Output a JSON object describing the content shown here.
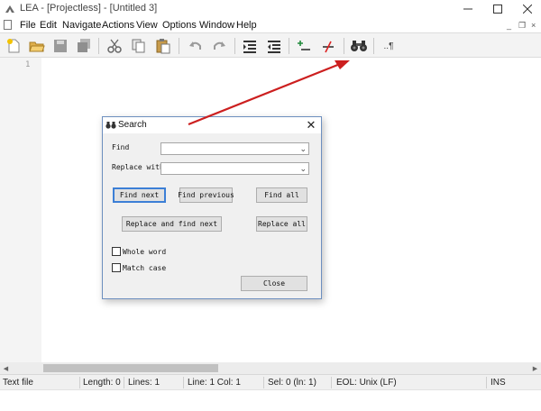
{
  "window": {
    "title": "LEA - [Projectless] - [Untitled 3]",
    "minimize_glyph": "—",
    "maximize_glyph": "☐",
    "close_glyph": "✕"
  },
  "menu": {
    "items": [
      "File",
      "Edit",
      "Navigate",
      "Actions",
      "View",
      "Options",
      "Window",
      "Help"
    ],
    "mdi_minimize": "_",
    "mdi_restore": "❐",
    "mdi_close": "×"
  },
  "toolbar": {
    "buttons": [
      "new-file-icon",
      "open-folder-icon",
      "save-icon",
      "save-all-icon",
      "cut-icon",
      "copy-icon",
      "paste-icon",
      "undo-icon",
      "redo-icon",
      "indent-icon",
      "unindent-icon",
      "comment-icon",
      "uncomment-icon",
      "find-icon",
      "show-whitespace-icon"
    ],
    "whitespace_glyph": "..¶"
  },
  "editor": {
    "line_number": "1"
  },
  "scrollbar": {
    "left_arrow": "◀",
    "right_arrow": "▶",
    "thumb_position": 0.0
  },
  "status": {
    "file_type": "Text file",
    "length": "Length: 0",
    "lines": "Lines: 1",
    "position": "Line: 1 Col: 1",
    "selection": "Sel: 0 (ln: 1)",
    "eol": "EOL: Unix (LF)",
    "mode": "INS"
  },
  "dialog": {
    "title": "Search",
    "close_glyph": "✕",
    "find_label": "Find",
    "find_value": "",
    "replace_label": "Replace with",
    "replace_value": "",
    "combo_arrow": "⌄",
    "find_next": "Find next",
    "find_previous": "Find previous",
    "find_all": "Find all",
    "replace_and_find_next": "Replace and find next",
    "replace_all": "Replace all",
    "whole_word": "Whole word",
    "whole_word_checked": false,
    "match_case": "Match case",
    "match_case_checked": false,
    "close_button": "Close"
  },
  "colors": {
    "accent": "#3c7fd6",
    "annotation_arrow": "#cc1f1f",
    "dialog_border": "#6d8fbf"
  }
}
